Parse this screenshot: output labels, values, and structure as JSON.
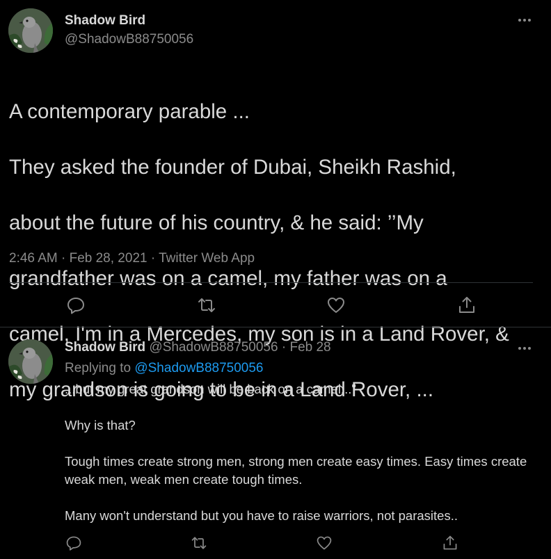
{
  "main_tweet": {
    "author_name": "Shadow Bird",
    "author_handle": "@ShadowB88750056",
    "lines": [
      "A contemporary parable ...",
      "They asked the founder of Dubai, Sheikh Rashid,",
      "about the future of his country, & he said: ’’My",
      "grandfather was on a camel, my father was on a",
      "camel, I'm in a Mercedes, my son is in a Land Rover, &",
      "my grandson is going to be in a Land Rover, ..."
    ],
    "meta": "2:46 AM · Feb 28, 2021 · Twitter Web App",
    "actions": {
      "reply_icon": "reply-icon",
      "retweet_icon": "retweet-icon",
      "like_icon": "heart-icon",
      "share_icon": "share-icon"
    }
  },
  "reply_tweet": {
    "author_name": "Shadow Bird",
    "author_handle": "@ShadowB88750056",
    "separator": "·",
    "date": "Feb 28",
    "replying_prefix": "Replying to",
    "replying_to": "@ShadowB88750056",
    "paragraphs": [
      "...but my great grandson will be back on a camel...\"",
      "Why is that?",
      "Tough times create strong men, strong men create easy times. Easy times create weak men, weak men create tough times.",
      "Many won't understand but you have to raise warriors, not parasites.."
    ]
  },
  "colors": {
    "background": "#000000",
    "text": "#d9d9d9",
    "muted": "#8b8b8b",
    "link": "#1d9bf0",
    "divider": "#2f3336"
  }
}
